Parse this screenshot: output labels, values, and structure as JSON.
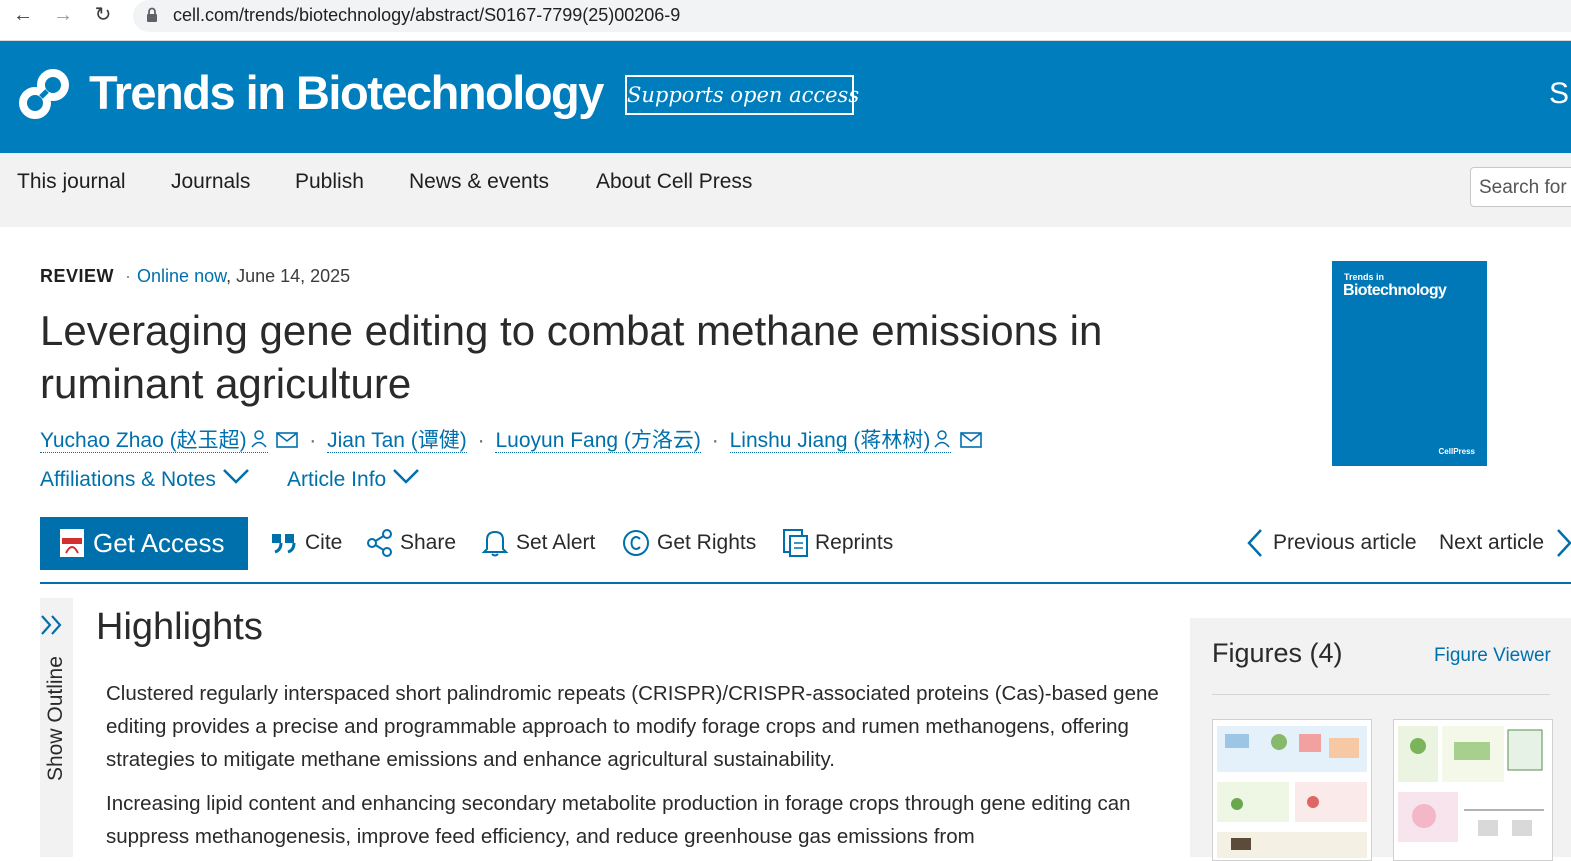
{
  "browser": {
    "back": "←",
    "forward": "→",
    "reload": "↻",
    "url": "cell.com/trends/biotechnology/abstract/S0167-7799(25)00206-9"
  },
  "header": {
    "journal_name": "Trends in Biotechnology",
    "open_access": "Supports open access",
    "truncated_label": "S"
  },
  "nav": {
    "items": [
      "This journal",
      "Journals",
      "Publish",
      "News & events",
      "About Cell Press"
    ],
    "search_placeholder": "Search for"
  },
  "article": {
    "type": "REVIEW",
    "sep": "·",
    "online": "Online now",
    "date": ", June 14, 2025",
    "title": "Leveraging gene editing to combat methane emissions in ruminant agriculture",
    "authors": [
      "Yuchao Zhao (赵玉超)",
      "Jian Tan (谭健)",
      "Luoyun Fang (方洛云)",
      "Linshu Jiang (蒋林树)"
    ],
    "author_sep": "·",
    "affiliations": "Affiliations & Notes",
    "article_info": "Article Info"
  },
  "cover": {
    "line1": "Trends in",
    "line2": "Biotechnology",
    "publisher": "CellPress"
  },
  "toolbar": {
    "get_access": "Get Access",
    "cite": "Cite",
    "share": "Share",
    "set_alert": "Set Alert",
    "get_rights": "Get Rights",
    "reprints": "Reprints",
    "previous": "Previous article",
    "next": "Next article"
  },
  "outline": {
    "label": "Show Outline"
  },
  "highlights": {
    "heading": "Highlights",
    "items": [
      "Clustered regularly interspaced short palindromic repeats (CRISPR)/CRISPR-associated proteins (Cas)-based gene editing provides a precise and programmable approach to modify forage crops and rumen methanogens, offering strategies to mitigate methane emissions and enhance agricultural sustainability.",
      "Increasing lipid content and enhancing secondary metabolite production in forage crops through gene editing can suppress methanogenesis, improve feed efficiency, and reduce greenhouse gas emissions from"
    ]
  },
  "figures": {
    "title": "Figures (4)",
    "viewer": "Figure Viewer"
  },
  "colors": {
    "brand_blue": "#007dbc",
    "link_blue": "#0070ad",
    "nav_gray": "#f2f2f2"
  }
}
